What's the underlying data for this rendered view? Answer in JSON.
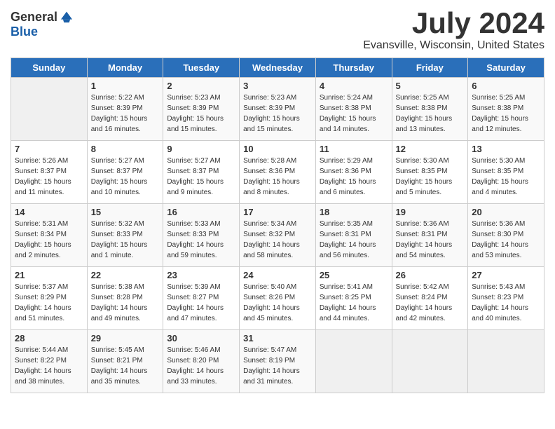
{
  "header": {
    "logo": {
      "line1": "General",
      "line2": "Blue"
    },
    "title": "July 2024",
    "location": "Evansville, Wisconsin, United States"
  },
  "days_of_week": [
    "Sunday",
    "Monday",
    "Tuesday",
    "Wednesday",
    "Thursday",
    "Friday",
    "Saturday"
  ],
  "weeks": [
    [
      {
        "day": "",
        "sunrise": "",
        "sunset": "",
        "daylight": "",
        "empty": true
      },
      {
        "day": "1",
        "sunrise": "Sunrise: 5:22 AM",
        "sunset": "Sunset: 8:39 PM",
        "daylight": "Daylight: 15 hours and 16 minutes."
      },
      {
        "day": "2",
        "sunrise": "Sunrise: 5:23 AM",
        "sunset": "Sunset: 8:39 PM",
        "daylight": "Daylight: 15 hours and 15 minutes."
      },
      {
        "day": "3",
        "sunrise": "Sunrise: 5:23 AM",
        "sunset": "Sunset: 8:39 PM",
        "daylight": "Daylight: 15 hours and 15 minutes."
      },
      {
        "day": "4",
        "sunrise": "Sunrise: 5:24 AM",
        "sunset": "Sunset: 8:38 PM",
        "daylight": "Daylight: 15 hours and 14 minutes."
      },
      {
        "day": "5",
        "sunrise": "Sunrise: 5:25 AM",
        "sunset": "Sunset: 8:38 PM",
        "daylight": "Daylight: 15 hours and 13 minutes."
      },
      {
        "day": "6",
        "sunrise": "Sunrise: 5:25 AM",
        "sunset": "Sunset: 8:38 PM",
        "daylight": "Daylight: 15 hours and 12 minutes."
      }
    ],
    [
      {
        "day": "7",
        "sunrise": "Sunrise: 5:26 AM",
        "sunset": "Sunset: 8:37 PM",
        "daylight": "Daylight: 15 hours and 11 minutes."
      },
      {
        "day": "8",
        "sunrise": "Sunrise: 5:27 AM",
        "sunset": "Sunset: 8:37 PM",
        "daylight": "Daylight: 15 hours and 10 minutes."
      },
      {
        "day": "9",
        "sunrise": "Sunrise: 5:27 AM",
        "sunset": "Sunset: 8:37 PM",
        "daylight": "Daylight: 15 hours and 9 minutes."
      },
      {
        "day": "10",
        "sunrise": "Sunrise: 5:28 AM",
        "sunset": "Sunset: 8:36 PM",
        "daylight": "Daylight: 15 hours and 8 minutes."
      },
      {
        "day": "11",
        "sunrise": "Sunrise: 5:29 AM",
        "sunset": "Sunset: 8:36 PM",
        "daylight": "Daylight: 15 hours and 6 minutes."
      },
      {
        "day": "12",
        "sunrise": "Sunrise: 5:30 AM",
        "sunset": "Sunset: 8:35 PM",
        "daylight": "Daylight: 15 hours and 5 minutes."
      },
      {
        "day": "13",
        "sunrise": "Sunrise: 5:30 AM",
        "sunset": "Sunset: 8:35 PM",
        "daylight": "Daylight: 15 hours and 4 minutes."
      }
    ],
    [
      {
        "day": "14",
        "sunrise": "Sunrise: 5:31 AM",
        "sunset": "Sunset: 8:34 PM",
        "daylight": "Daylight: 15 hours and 2 minutes."
      },
      {
        "day": "15",
        "sunrise": "Sunrise: 5:32 AM",
        "sunset": "Sunset: 8:33 PM",
        "daylight": "Daylight: 15 hours and 1 minute."
      },
      {
        "day": "16",
        "sunrise": "Sunrise: 5:33 AM",
        "sunset": "Sunset: 8:33 PM",
        "daylight": "Daylight: 14 hours and 59 minutes."
      },
      {
        "day": "17",
        "sunrise": "Sunrise: 5:34 AM",
        "sunset": "Sunset: 8:32 PM",
        "daylight": "Daylight: 14 hours and 58 minutes."
      },
      {
        "day": "18",
        "sunrise": "Sunrise: 5:35 AM",
        "sunset": "Sunset: 8:31 PM",
        "daylight": "Daylight: 14 hours and 56 minutes."
      },
      {
        "day": "19",
        "sunrise": "Sunrise: 5:36 AM",
        "sunset": "Sunset: 8:31 PM",
        "daylight": "Daylight: 14 hours and 54 minutes."
      },
      {
        "day": "20",
        "sunrise": "Sunrise: 5:36 AM",
        "sunset": "Sunset: 8:30 PM",
        "daylight": "Daylight: 14 hours and 53 minutes."
      }
    ],
    [
      {
        "day": "21",
        "sunrise": "Sunrise: 5:37 AM",
        "sunset": "Sunset: 8:29 PM",
        "daylight": "Daylight: 14 hours and 51 minutes."
      },
      {
        "day": "22",
        "sunrise": "Sunrise: 5:38 AM",
        "sunset": "Sunset: 8:28 PM",
        "daylight": "Daylight: 14 hours and 49 minutes."
      },
      {
        "day": "23",
        "sunrise": "Sunrise: 5:39 AM",
        "sunset": "Sunset: 8:27 PM",
        "daylight": "Daylight: 14 hours and 47 minutes."
      },
      {
        "day": "24",
        "sunrise": "Sunrise: 5:40 AM",
        "sunset": "Sunset: 8:26 PM",
        "daylight": "Daylight: 14 hours and 45 minutes."
      },
      {
        "day": "25",
        "sunrise": "Sunrise: 5:41 AM",
        "sunset": "Sunset: 8:25 PM",
        "daylight": "Daylight: 14 hours and 44 minutes."
      },
      {
        "day": "26",
        "sunrise": "Sunrise: 5:42 AM",
        "sunset": "Sunset: 8:24 PM",
        "daylight": "Daylight: 14 hours and 42 minutes."
      },
      {
        "day": "27",
        "sunrise": "Sunrise: 5:43 AM",
        "sunset": "Sunset: 8:23 PM",
        "daylight": "Daylight: 14 hours and 40 minutes."
      }
    ],
    [
      {
        "day": "28",
        "sunrise": "Sunrise: 5:44 AM",
        "sunset": "Sunset: 8:22 PM",
        "daylight": "Daylight: 14 hours and 38 minutes."
      },
      {
        "day": "29",
        "sunrise": "Sunrise: 5:45 AM",
        "sunset": "Sunset: 8:21 PM",
        "daylight": "Daylight: 14 hours and 35 minutes."
      },
      {
        "day": "30",
        "sunrise": "Sunrise: 5:46 AM",
        "sunset": "Sunset: 8:20 PM",
        "daylight": "Daylight: 14 hours and 33 minutes."
      },
      {
        "day": "31",
        "sunrise": "Sunrise: 5:47 AM",
        "sunset": "Sunset: 8:19 PM",
        "daylight": "Daylight: 14 hours and 31 minutes."
      },
      {
        "day": "",
        "sunrise": "",
        "sunset": "",
        "daylight": "",
        "empty": true
      },
      {
        "day": "",
        "sunrise": "",
        "sunset": "",
        "daylight": "",
        "empty": true
      },
      {
        "day": "",
        "sunrise": "",
        "sunset": "",
        "daylight": "",
        "empty": true
      }
    ]
  ]
}
